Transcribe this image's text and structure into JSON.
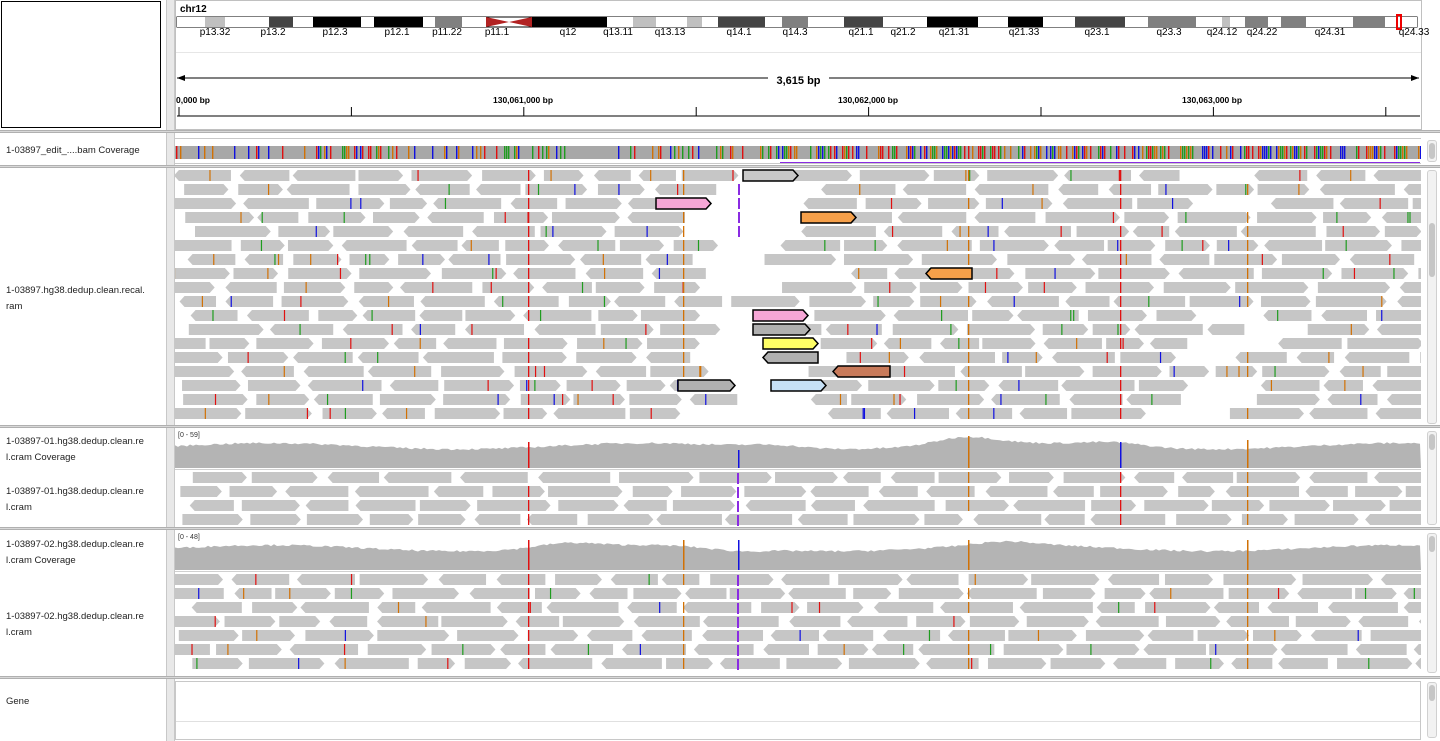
{
  "header": {
    "chromosome": "chr12",
    "range_text": "3,615 bp",
    "cytobands": [
      "p13.32",
      "p13.2",
      "p12.3",
      "p12.1",
      "p11.22",
      "p11.1",
      "q12",
      "q13.11",
      "q13.13",
      "q14.1",
      "q14.3",
      "q21.1",
      "q21.2",
      "q21.31",
      "q21.33",
      "q23.1",
      "q23.3",
      "q24.12",
      "q24.22",
      "q24.31",
      "q24.33"
    ],
    "ticks": [
      "0,000 bp",
      "130,061,000 bp",
      "130,062,000 bp",
      "130,063,000 bp"
    ]
  },
  "tracks": {
    "bam_coverage": "1-03897_edit_....bam Coverage",
    "main_alignments": "1-03897.hg38.dedup.clean.recal.\nram",
    "sample01_coverage": "1-03897-01.hg38.dedup.clean.re\nl.cram Coverage",
    "sample01_alignments": "1-03897-01.hg38.dedup.clean.re\nl.cram",
    "sample02_coverage": "1-03897-02.hg38.dedup.clean.re\nl.cram Coverage",
    "sample02_alignments": "1-03897-02.hg38.dedup.clean.re\nl.cram",
    "gene": "Gene"
  },
  "scales": {
    "sample01": "[0 - 59]",
    "sample02": "[0 - 48]"
  },
  "colors": {
    "read_gray": "#c6c6c6",
    "coverage_gray": "#b4b4b4",
    "mismatch_a": "#1f9c1f",
    "mismatch_c": "#1010e0",
    "mismatch_g": "#d17105",
    "mismatch_t": "#e01010",
    "insertion": "#8a2be2",
    "highlight_pink": "#f6a6d6",
    "highlight_orange": "#f6a04a",
    "highlight_yellow": "#ffff66",
    "highlight_blue": "#c6e0f6",
    "highlight_brown": "#c87a5a",
    "centromere": "#b22222"
  }
}
